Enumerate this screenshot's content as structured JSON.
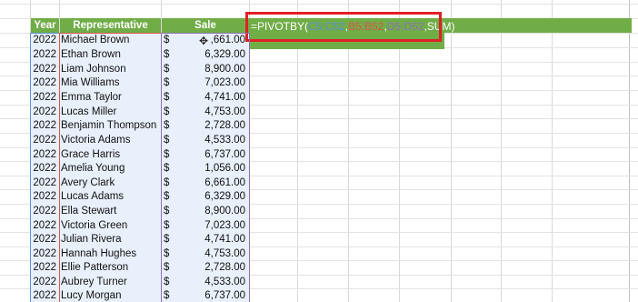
{
  "headers": {
    "year": "Year",
    "representative": "Representative",
    "sale": "Sale"
  },
  "currency_symbol": "$",
  "rows": [
    {
      "year": "2022",
      "name": "Michael Brown",
      "sale": ",661.00"
    },
    {
      "year": "2022",
      "name": "Ethan Brown",
      "sale": "6,329.00"
    },
    {
      "year": "2022",
      "name": "Liam Johnson",
      "sale": "8,900.00"
    },
    {
      "year": "2022",
      "name": "Mia Williams",
      "sale": "7,023.00"
    },
    {
      "year": "2022",
      "name": "Emma Taylor",
      "sale": "4,741.00"
    },
    {
      "year": "2022",
      "name": "Lucas Miller",
      "sale": "4,753.00"
    },
    {
      "year": "2022",
      "name": "Benjamin Thompson",
      "sale": "2,728.00"
    },
    {
      "year": "2022",
      "name": "Victoria Adams",
      "sale": "4,533.00"
    },
    {
      "year": "2022",
      "name": "Grace Harris",
      "sale": "6,737.00"
    },
    {
      "year": "2022",
      "name": "Amelia Young",
      "sale": "1,056.00"
    },
    {
      "year": "2022",
      "name": "Avery Clark",
      "sale": "6,661.00"
    },
    {
      "year": "2022",
      "name": "Lucas Adams",
      "sale": "6,329.00"
    },
    {
      "year": "2022",
      "name": "Ella Stewart",
      "sale": "8,900.00"
    },
    {
      "year": "2022",
      "name": "Victoria Green",
      "sale": "7,023.00"
    },
    {
      "year": "2022",
      "name": "Julian Rivera",
      "sale": "4,741.00"
    },
    {
      "year": "2022",
      "name": "Hannah Hughes",
      "sale": "4,753.00"
    },
    {
      "year": "2022",
      "name": "Ellie Patterson",
      "sale": "2,728.00"
    },
    {
      "year": "2022",
      "name": "Aubrey Turner",
      "sale": "4,533.00"
    },
    {
      "year": "2022",
      "name": "Lucy Morgan",
      "sale": "6,737.00"
    }
  ],
  "formula": {
    "prefix": "=PIVOTBY(",
    "arg1": "C5:C52",
    "sep1": ",",
    "arg2": "B5:B52",
    "sep2": ",",
    "arg3": "D5:D52",
    "suffix": ",SUM)"
  },
  "colors": {
    "header_green": "#70ad47",
    "highlight_red": "#e01f26",
    "ref_blue": "#5b8fd6",
    "ref_red": "#d9534f",
    "ref_purple": "#8e6fb7"
  },
  "icons": {
    "cursor": "move-cursor-icon"
  }
}
